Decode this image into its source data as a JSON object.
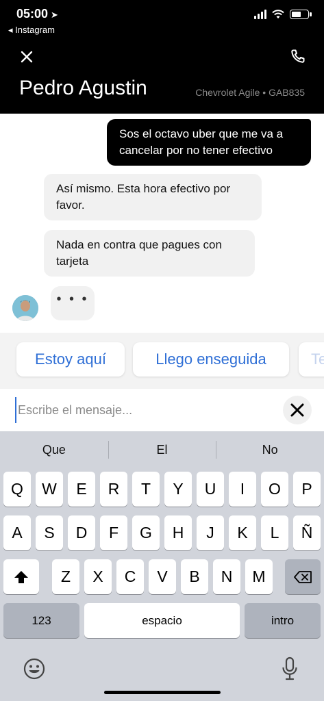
{
  "status_bar": {
    "time": "05:00",
    "back_app": "◂ Instagram"
  },
  "header": {
    "driver_name": "Pedro Agustin",
    "vehicle": "Chevrolet Agile • GAB835"
  },
  "messages": [
    {
      "from": "me",
      "text": "Sos el octavo uber que me va a cancelar por no tener efectivo"
    },
    {
      "from": "driver",
      "text": "Así mismo. Esta hora efectivo por favor."
    },
    {
      "from": "driver",
      "text": "Nada en contra que pagues con tarjeta"
    }
  ],
  "typing_indicator": "• • •",
  "quick_replies": [
    "Estoy aquí",
    "Llego enseguida",
    "Te"
  ],
  "input": {
    "placeholder": "Escribe el mensaje...",
    "value": ""
  },
  "keyboard": {
    "suggestions": [
      "Que",
      "El",
      "No"
    ],
    "row1": [
      "Q",
      "W",
      "E",
      "R",
      "T",
      "Y",
      "U",
      "I",
      "O",
      "P"
    ],
    "row2": [
      "A",
      "S",
      "D",
      "F",
      "G",
      "H",
      "J",
      "K",
      "L",
      "Ñ"
    ],
    "row3": [
      "Z",
      "X",
      "C",
      "V",
      "B",
      "N",
      "M"
    ],
    "numbers_key": "123",
    "space_key": "espacio",
    "return_key": "intro"
  },
  "icons": {
    "close": "close-icon",
    "phone": "phone-icon",
    "clear": "clear-icon",
    "shift": "shift-icon",
    "backspace": "backspace-icon",
    "emoji": "emoji-icon",
    "mic": "microphone-icon"
  },
  "colors": {
    "header_bg": "#000000",
    "accent": "#2f6fd6",
    "bubble_me": "#000000",
    "bubble_them": "#f1f1f1"
  },
  "battery_level": 0.6,
  "signal_bars": 4
}
